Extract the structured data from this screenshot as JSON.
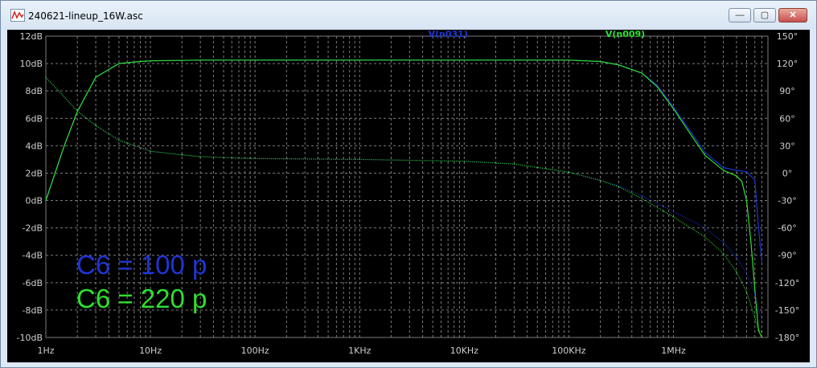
{
  "window": {
    "title": "240621-lineup_16W.asc",
    "minimize_glyph": "—",
    "maximize_glyph": "▢",
    "close_glyph": "✕"
  },
  "colors": {
    "background": "#000000",
    "grid": "#7c7c7c",
    "axis_text": "#cfcfcf",
    "series_blue": "#1f35d6",
    "series_green": "#2de02d"
  },
  "chart_data": {
    "type": "line",
    "title": "",
    "xlabel": "",
    "ylabel": "",
    "x_scale": "log",
    "xlim": [
      1,
      8000000
    ],
    "x_ticks": [
      {
        "value": 1,
        "label": "1Hz"
      },
      {
        "value": 10,
        "label": "10Hz"
      },
      {
        "value": 100,
        "label": "100Hz"
      },
      {
        "value": 1000,
        "label": "1KHz"
      },
      {
        "value": 10000,
        "label": "10KHz"
      },
      {
        "value": 100000,
        "label": "100KHz"
      },
      {
        "value": 1000000,
        "label": "1MHz"
      }
    ],
    "left_axis": {
      "unit": "dB",
      "ylim": [
        -10,
        12
      ],
      "ticks": [
        "12dB",
        "10dB",
        "8dB",
        "6dB",
        "4dB",
        "2dB",
        "0dB",
        "-2dB",
        "-4dB",
        "-6dB",
        "-8dB",
        "-10dB"
      ],
      "values": [
        12,
        10,
        8,
        6,
        4,
        2,
        0,
        -2,
        -4,
        -6,
        -8,
        -10
      ]
    },
    "right_axis": {
      "unit": "°",
      "ylim": [
        -180,
        150
      ],
      "ticks": [
        "150°",
        "120°",
        "90°",
        "60°",
        "30°",
        "0°",
        "-30°",
        "-60°",
        "-90°",
        "-120°",
        "-150°",
        "-180°"
      ],
      "values": [
        150,
        120,
        90,
        60,
        30,
        0,
        -30,
        -60,
        -90,
        -120,
        -150,
        -180
      ]
    },
    "grid": true,
    "legend": [
      {
        "name": "V(n031)",
        "color": "#1f35d6"
      },
      {
        "name": "V(n009)",
        "color": "#2de02d"
      }
    ],
    "annotations": [
      {
        "text": "C6 = 100 p",
        "color": "#1f35d6"
      },
      {
        "text": "C6 = 220 p",
        "color": "#2de02d"
      }
    ],
    "series": [
      {
        "name": "V(n031)",
        "quantity": "magnitude",
        "color": "#1f35d6",
        "x": [
          1,
          1.5,
          2,
          3,
          5,
          8,
          10,
          30,
          100,
          1000,
          10000,
          100000,
          200000,
          300000,
          500000,
          700000,
          1000000,
          1500000,
          2000000,
          3000000,
          4000000,
          5000000,
          6000000,
          6500000,
          7000000
        ],
        "values": [
          0,
          4,
          6.5,
          9,
          10,
          10.15,
          10.2,
          10.25,
          10.25,
          10.25,
          10.25,
          10.25,
          10.15,
          9.9,
          9.3,
          8.4,
          6.8,
          4.9,
          3.5,
          2.4,
          2.2,
          2.1,
          1.5,
          -2,
          -4.5
        ]
      },
      {
        "name": "V(n009)",
        "quantity": "magnitude",
        "color": "#2de02d",
        "x": [
          1,
          1.5,
          2,
          3,
          5,
          8,
          10,
          30,
          100,
          1000,
          10000,
          100000,
          200000,
          300000,
          500000,
          700000,
          1000000,
          1500000,
          2000000,
          3000000,
          4000000,
          4500000,
          5000000,
          5500000,
          6000000,
          6500000,
          7000000
        ],
        "values": [
          0,
          4,
          6.5,
          9,
          10,
          10.15,
          10.2,
          10.25,
          10.25,
          10.25,
          10.25,
          10.25,
          10.15,
          9.9,
          9.3,
          8.3,
          6.7,
          4.7,
          3.3,
          2.2,
          1.8,
          1.4,
          0,
          -3,
          -6.5,
          -9.5,
          -10
        ]
      },
      {
        "name": "V(n031)",
        "quantity": "phase",
        "color": "#1f35d6",
        "x": [
          1,
          2,
          3,
          5,
          10,
          20,
          30,
          100,
          1000,
          10000,
          30000,
          100000,
          200000,
          300000,
          500000,
          1000000,
          2000000,
          3000000,
          4000000,
          5000000,
          6000000,
          6500000,
          7000000
        ],
        "values": [
          105,
          68,
          52,
          36,
          24,
          20,
          18,
          16,
          15,
          13,
          10,
          1,
          -8,
          -14,
          -25,
          -42,
          -60,
          -76,
          -92,
          -110,
          -132,
          -150,
          -160
        ]
      },
      {
        "name": "V(n009)",
        "quantity": "phase",
        "color": "#2de02d",
        "x": [
          1,
          2,
          3,
          5,
          10,
          20,
          30,
          100,
          1000,
          10000,
          30000,
          100000,
          200000,
          300000,
          500000,
          1000000,
          2000000,
          3000000,
          4000000,
          5000000,
          6000000,
          6500000,
          7000000
        ],
        "values": [
          105,
          68,
          52,
          36,
          24,
          20,
          18,
          16,
          15,
          13,
          10,
          1,
          -8,
          -15,
          -28,
          -48,
          -70,
          -88,
          -108,
          -130,
          -158,
          -172,
          -174
        ]
      }
    ]
  }
}
